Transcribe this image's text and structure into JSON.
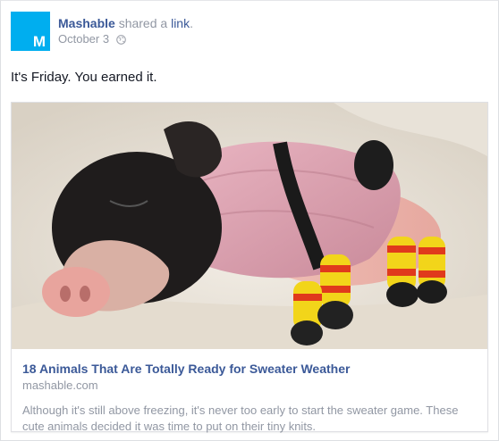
{
  "post": {
    "avatar_letter": "M",
    "author": "Mashable",
    "action_verb": " shared a ",
    "action_object": "link",
    "action_end": ".",
    "date": "October 3",
    "privacy_icon": "globe-icon",
    "message": "It's Friday. You earned it."
  },
  "shared_link": {
    "image_subject": "piglet-in-sweater-photo",
    "title": "18 Animals That Are Totally Ready for Sweater Weather",
    "domain": "mashable.com",
    "description": "Although it's still above freezing, it's never too early to start the sweater game. These cute animals decided it was time to put on their tiny knits."
  },
  "colors": {
    "brand_avatar": "#00aeef",
    "link_blue": "#3b5998",
    "meta_gray": "#9197a3",
    "text": "#141823"
  }
}
